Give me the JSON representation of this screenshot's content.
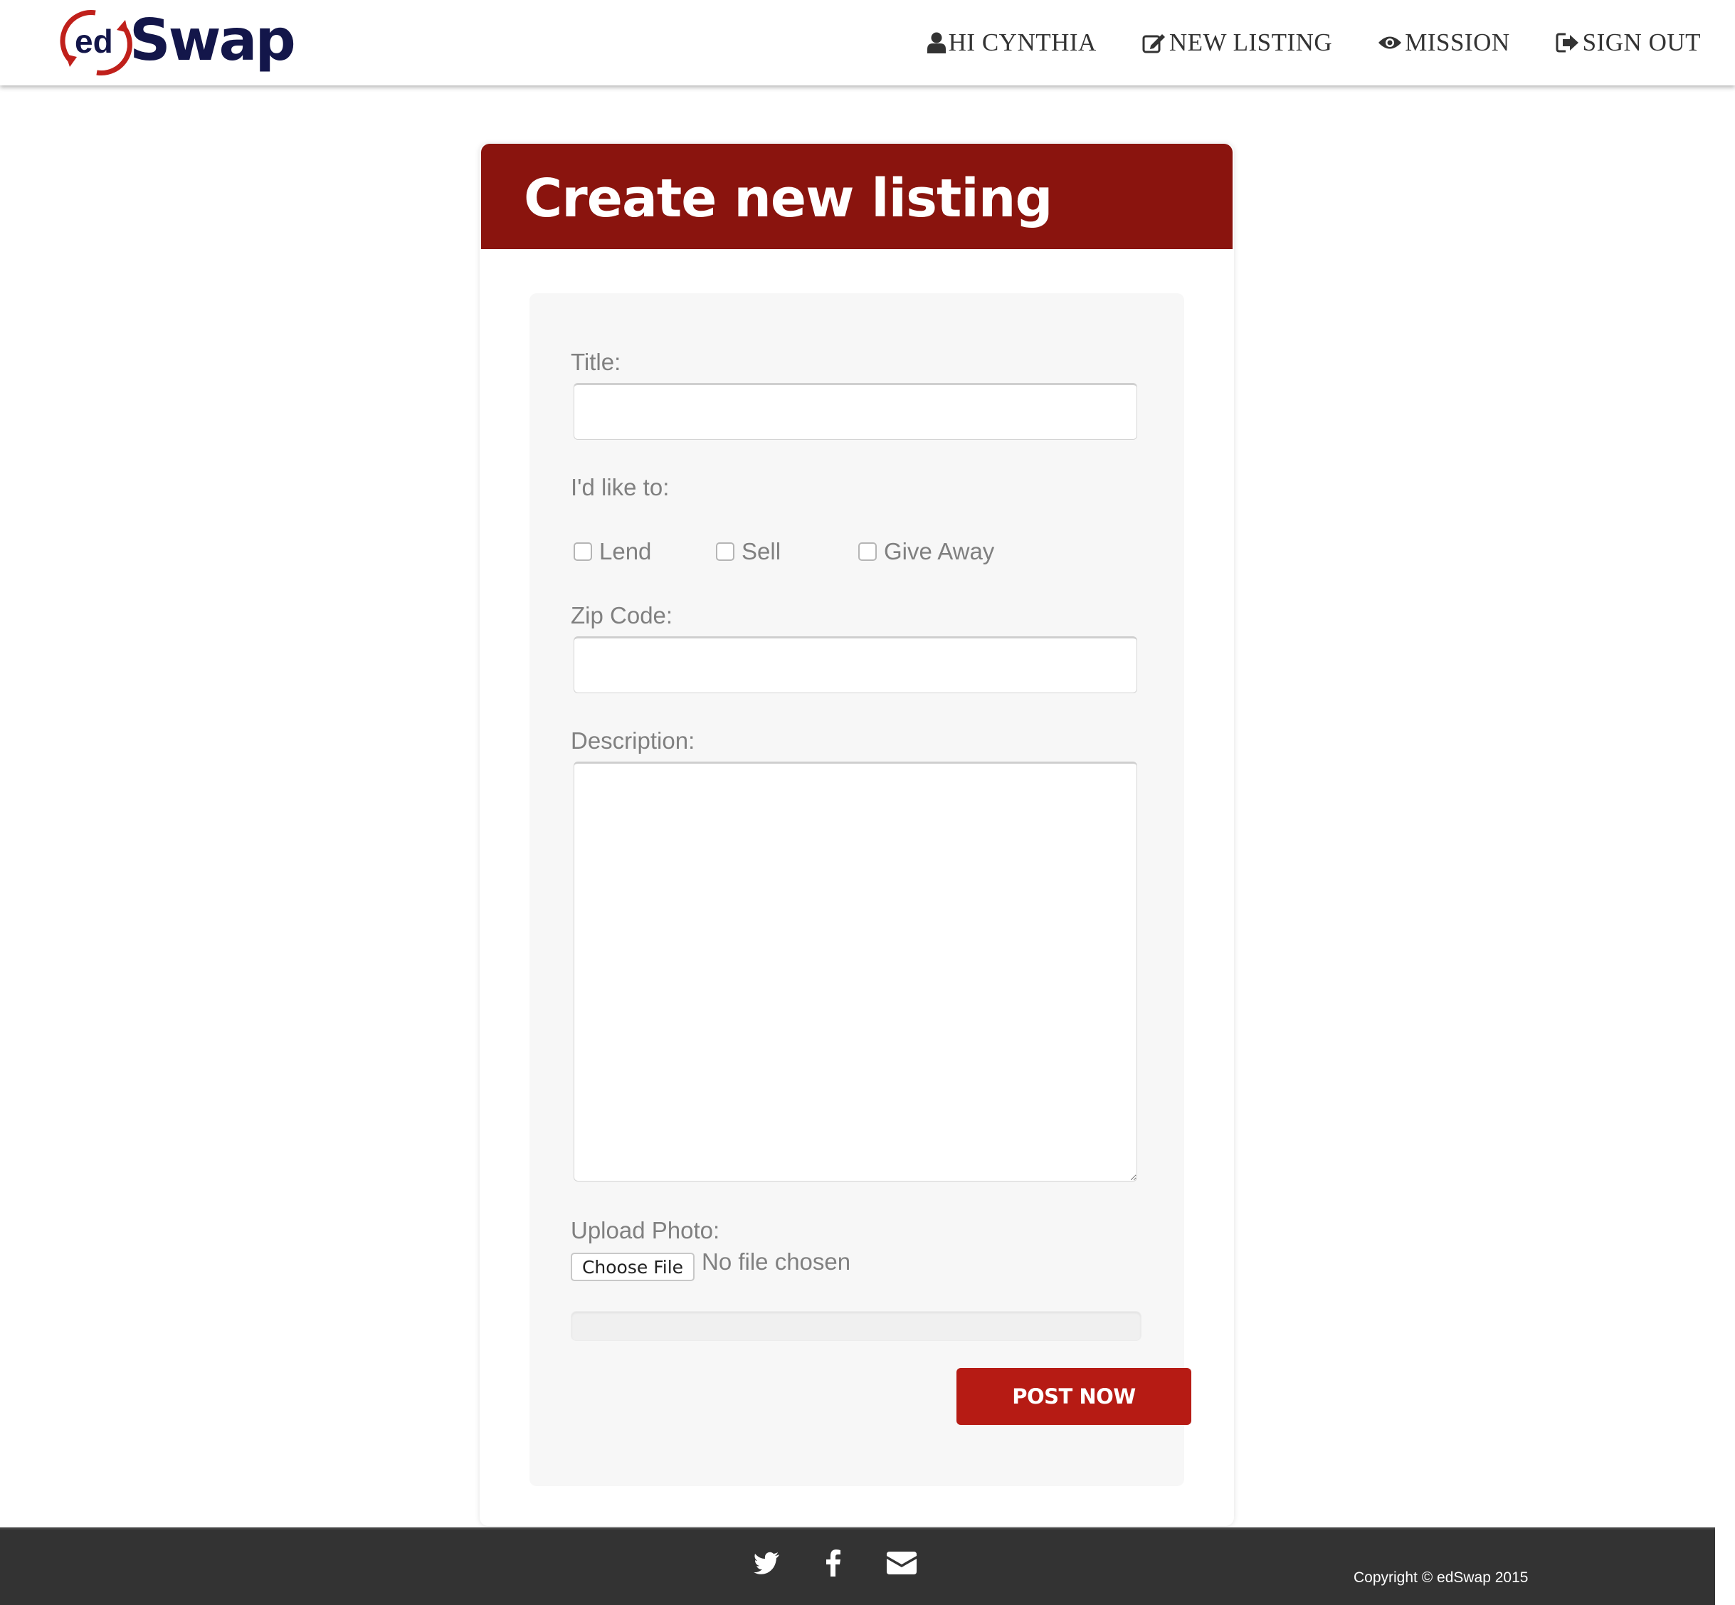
{
  "brand": {
    "logo_prefix": "ed",
    "logo_text": "Swap",
    "accent": "#c0201b",
    "navy": "#13164a"
  },
  "nav": {
    "items": [
      {
        "label": "HI CYNTHIA",
        "icon": "user-icon"
      },
      {
        "label": "NEW LISTING",
        "icon": "edit-icon"
      },
      {
        "label": "MISSION",
        "icon": "eye-icon"
      },
      {
        "label": "SIGN OUT",
        "icon": "sign-out-icon"
      }
    ]
  },
  "listing_form": {
    "title": "Create new listing",
    "title_label": "Title:",
    "title_value": "",
    "action_label": "I'd like to:",
    "options": [
      {
        "label": "Lend",
        "checked": false
      },
      {
        "label": "Sell",
        "checked": false
      },
      {
        "label": "Give Away",
        "checked": false
      }
    ],
    "zip_label": "Zip Code:",
    "zip_value": "",
    "description_label": "Description:",
    "description_value": "",
    "upload_label": "Upload Photo:",
    "choose_file_label": "Choose File",
    "no_file_text": "No file chosen",
    "submit_label": "POST NOW",
    "header_color": "#8a140e",
    "submit_color": "#b61b14"
  },
  "footer": {
    "social_icons": [
      "twitter-icon",
      "facebook-icon",
      "envelope-icon"
    ],
    "copyright": "Copyright © edSwap 2015"
  }
}
